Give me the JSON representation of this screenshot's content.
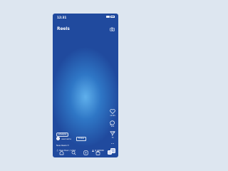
{
  "status": {
    "time": "12:31"
  },
  "header": {
    "title": "Reels"
  },
  "rail": {
    "like_count": "12345",
    "comment_count": "600",
    "share_count": "75"
  },
  "post": {
    "tag": "Lifestyle",
    "username": "username",
    "follow_label": "Follow",
    "caption": "New Reels!!!",
    "music": "New Music / Artist",
    "people": "Jk_000000"
  },
  "colors": {
    "background": "#dde6f0",
    "screen_top": "#204a9e",
    "screen_center": "#5fb0ec"
  },
  "icons": {
    "camera": "camera-icon",
    "like": "heart-icon",
    "comment": "comment-icon",
    "share": "send-icon",
    "more": "more-icon",
    "home": "home-icon",
    "search": "search-icon",
    "reels": "reels-icon",
    "shop": "shop-icon",
    "profile": "profile-icon"
  }
}
